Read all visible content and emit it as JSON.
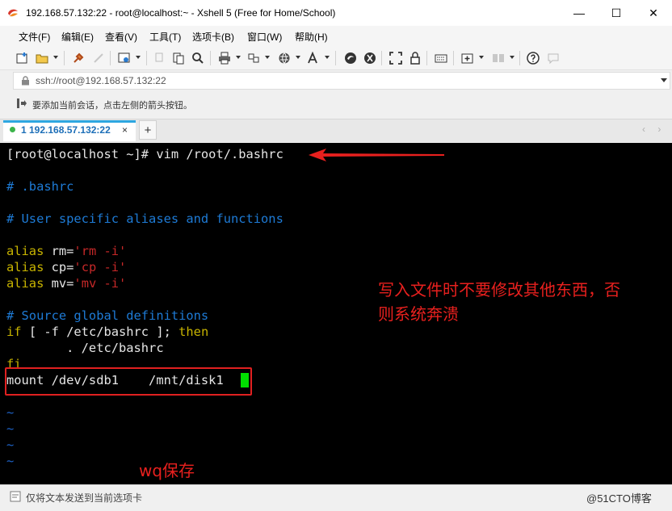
{
  "window": {
    "title": "192.168.57.132:22 - root@localhost:~ - Xshell 5 (Free for Home/School)",
    "controls": {
      "minimize": "—",
      "maximize": "☐",
      "close": "✕"
    }
  },
  "menu": [
    "文件(F)",
    "编辑(E)",
    "查看(V)",
    "工具(T)",
    "选项卡(B)",
    "窗口(W)",
    "帮助(H)"
  ],
  "address": {
    "value": "ssh://root@192.168.57.132:22",
    "icon": "lock-icon"
  },
  "hint": {
    "text": "要添加当前会话，点击左侧的箭头按钮。"
  },
  "tabs": {
    "active_label": "1 192.168.57.132:22",
    "close": "×",
    "add": "+",
    "nav": "‹ ›"
  },
  "terminal": {
    "prompt": "[root@localhost ~]# vim /root/.bashrc",
    "comment_file": "# .bashrc",
    "comment_user": "# User specific aliases and functions",
    "aliases": [
      {
        "kw": "alias",
        "name": " rm=",
        "val": "'rm -i'"
      },
      {
        "kw": "alias",
        "name": " cp=",
        "val": "'cp -i'"
      },
      {
        "kw": "alias",
        "name": " mv=",
        "val": "'mv -i'"
      }
    ],
    "comment_source": "# Source global definitions",
    "if_kw": "if",
    "if_body": " [ -f /etc/bashrc ]; ",
    "then_kw": "then",
    "source_line": "        . /etc/bashrc",
    "fi_kw": "fi",
    "mount_line": "mount /dev/sdb1    /mnt/disk1",
    "tildes": [
      "~",
      "~",
      "~",
      "~"
    ]
  },
  "annotations": {
    "warning_line1": "写入文件时不要修改其他东西，否",
    "warning_line2": "则系统奔溃",
    "save_note": "wq保存",
    "color": "#e8201e"
  },
  "status": {
    "text": "仅将文本发送到当前选项卡",
    "watermark": "@51CTO博客"
  }
}
